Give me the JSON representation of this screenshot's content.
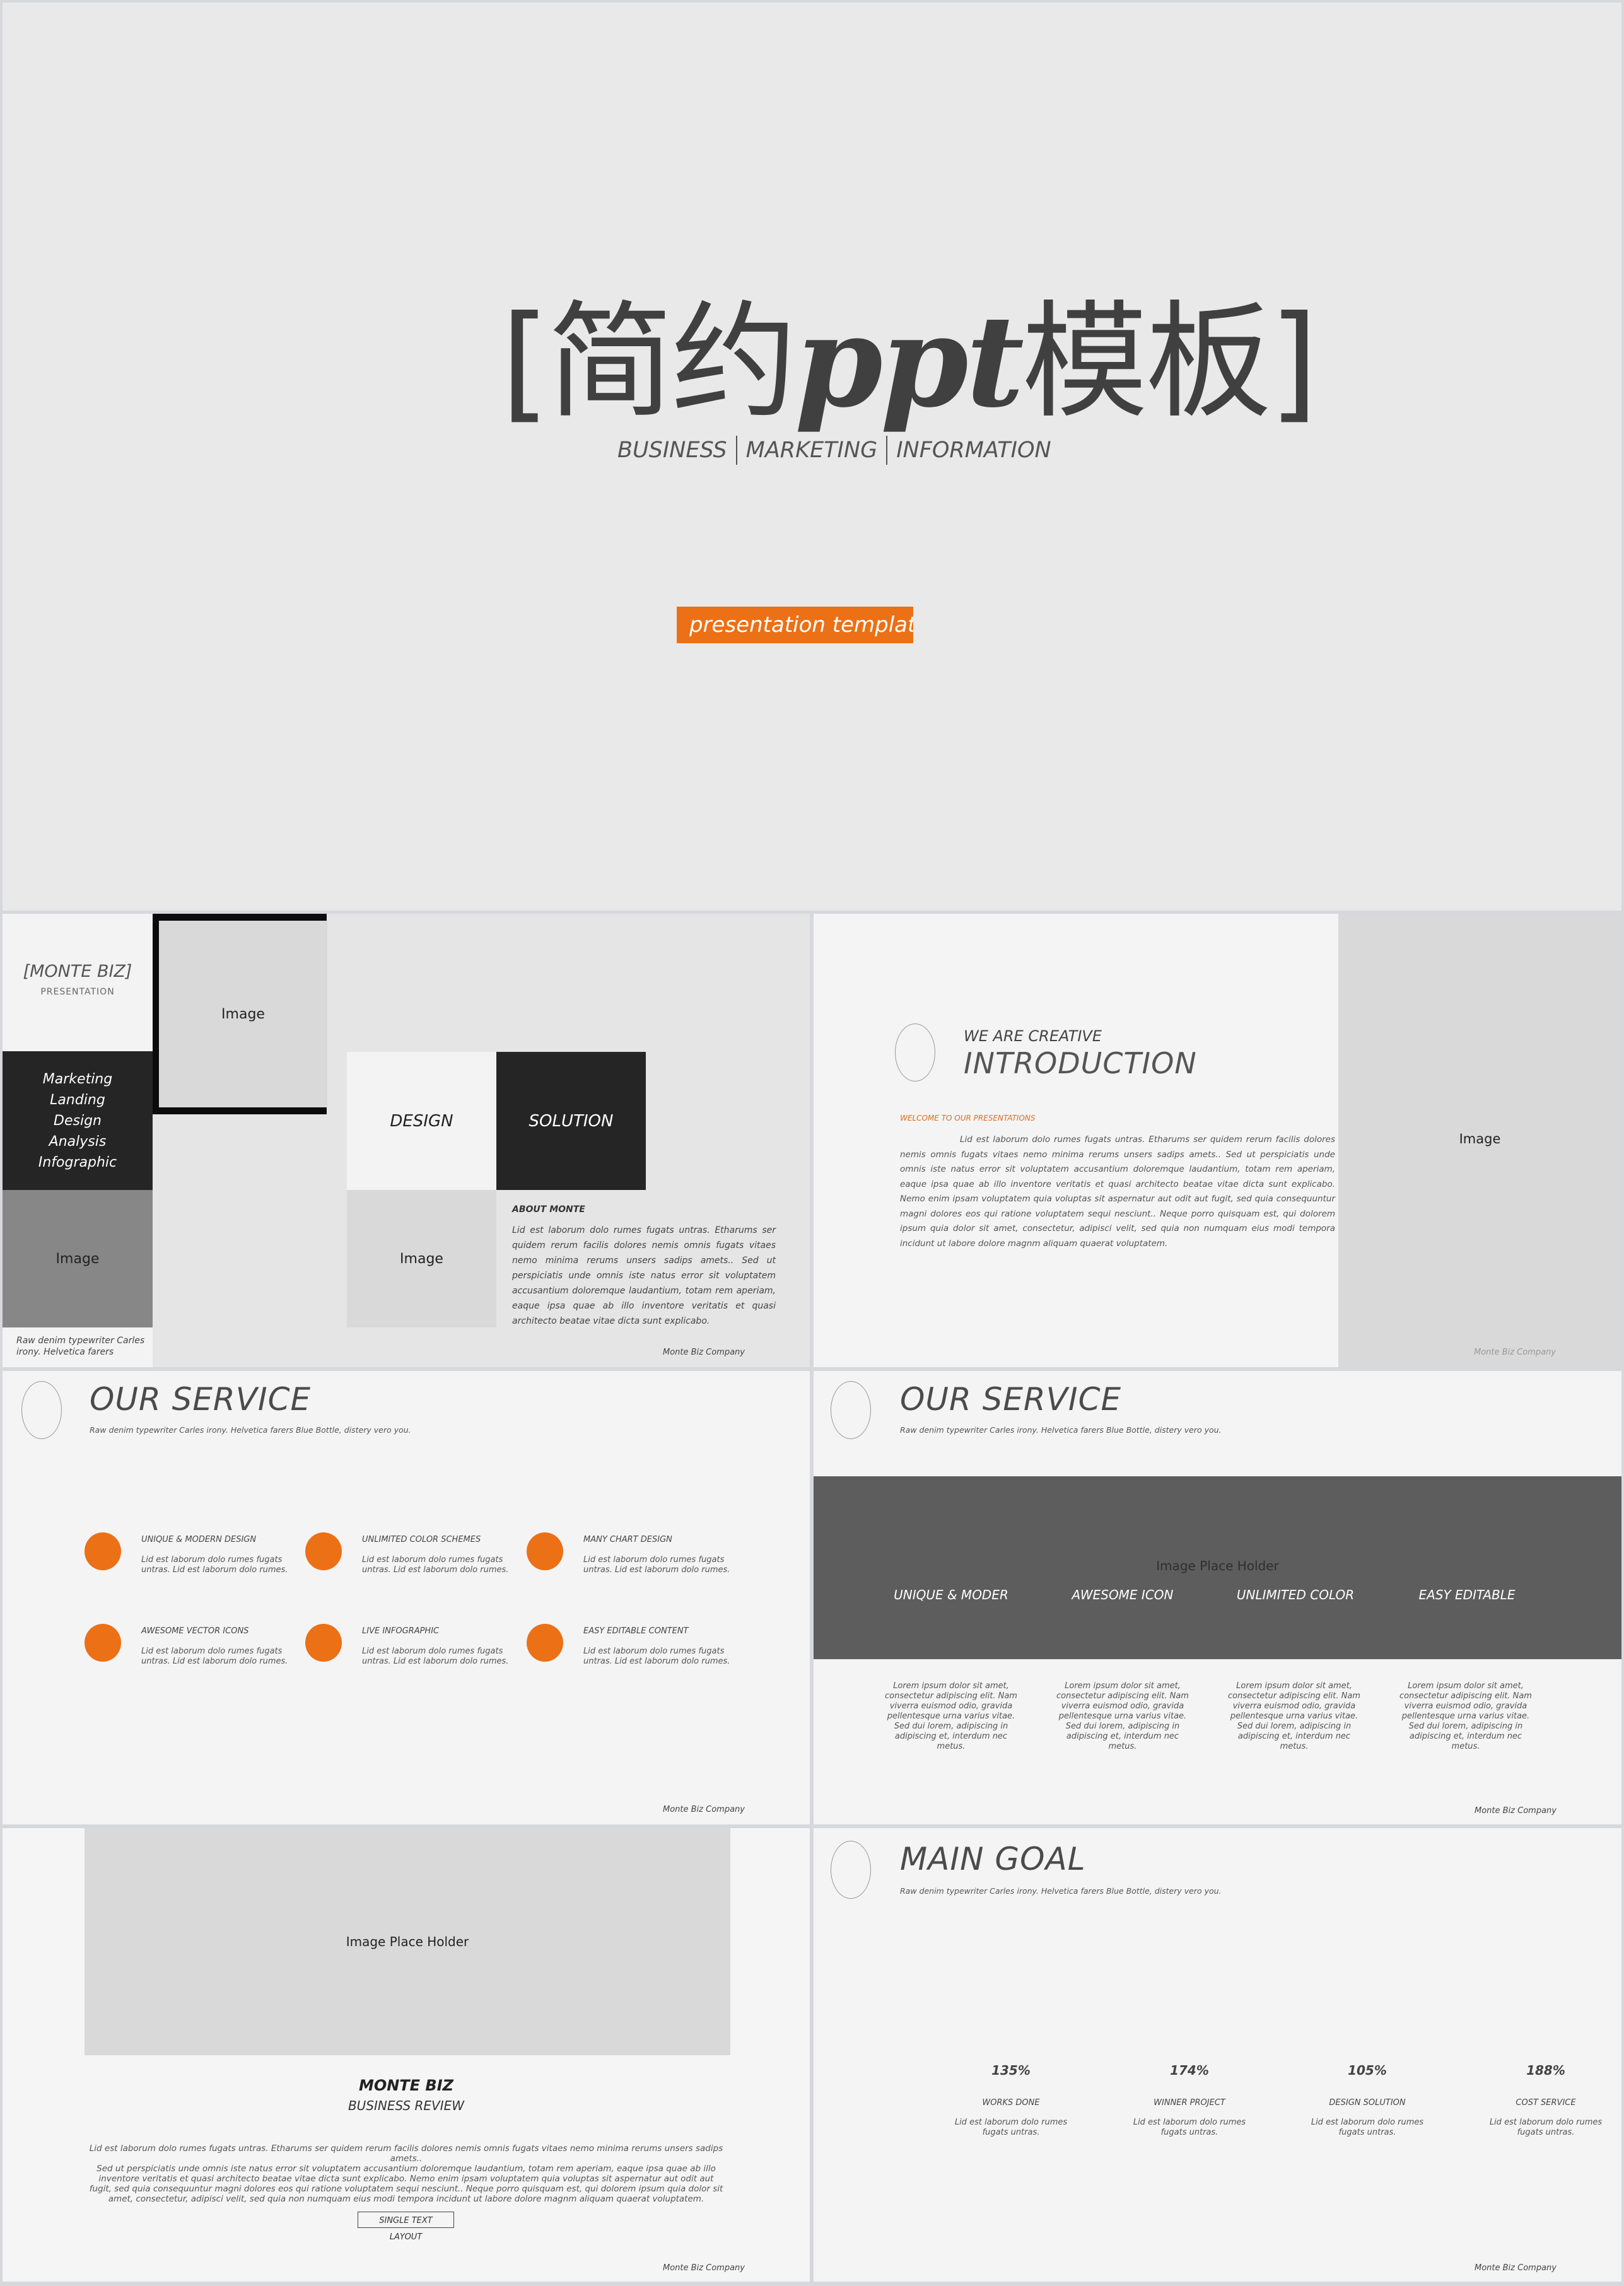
{
  "accent_color": "#ec7016",
  "slides": {
    "cover": {
      "title_open": "[",
      "title_cn1": "简约",
      "title_latin": "ppt",
      "title_cn2": "模板",
      "title_close": "]",
      "subtitle_items": [
        "BUSINESS",
        "MARKETING",
        "INFORMATION"
      ],
      "tag": "presentation template"
    },
    "monte": {
      "brand": "[MONTE BIZ]",
      "brand_sub": "PRESENTATION",
      "list": [
        "Marketing",
        "Landing",
        "Design",
        "Analysis",
        "Infographic"
      ],
      "image_label": "Image",
      "caption": "Raw denim typewriter Carles irony. Helvetica farers",
      "design": "DESIGN",
      "solution": "SOLUTION",
      "about_heading": "ABOUT MONTE",
      "about_body": "Lid est laborum dolo rumes fugats untras. Etharums ser quidem rerum facilis dolores nemis omnis fugats vitaes nemo minima rerums unsers sadips amets.. Sed ut perspiciatis unde omnis iste natus error sit voluptatem accusantium doloremque laudantium, totam rem aperiam, eaque ipsa quae ab illo inventore veritatis et quasi architecto beatae vitae dicta sunt explicabo.",
      "footer": "Monte Biz Company"
    },
    "intro": {
      "kicker": "WE ARE CREATIVE",
      "title": "INTRODUCTION",
      "welcome": "WELCOME TO OUR PRESENTATIONS",
      "body": "Lid est laborum dolo rumes fugats untras. Etharums ser quidem rerum facilis dolores nemis omnis fugats vitaes nemo minima rerums unsers sadips amets.. Sed ut perspiciatis unde omnis iste natus error sit voluptatem accusantium doloremque laudantium, totam rem aperiam, eaque ipsa quae ab illo inventore veritatis et quasi architecto beatae vitae dicta sunt explicabo. Nemo enim ipsam voluptatem quia voluptas sit aspernatur aut odit aut fugit, sed quia consequuntur magni dolores eos qui ratione voluptatem sequi nesciunt.. Neque porro quisquam est, qui dolorem ipsum quia dolor sit amet, consectetur, adipisci velit, sed quia non numquam eius modi tempora incidunt ut labore dolore magnm aliquam quaerat voluptatem.",
      "image_label": "Image",
      "footer": "Monte Biz Company"
    },
    "service1": {
      "title": "OUR SERVICE",
      "subtitle": "Raw denim typewriter Carles irony. Helvetica farers Blue Bottle, distery vero you.",
      "features": [
        {
          "heading": "UNIQUE & MODERN DESIGN",
          "body": "Lid est laborum dolo rumes fugats untras. Lid est laborum dolo rumes."
        },
        {
          "heading": "UNLIMITED COLOR SCHEMES",
          "body": "Lid est laborum dolo rumes fugats untras. Lid est laborum dolo rumes."
        },
        {
          "heading": "MANY CHART DESIGN",
          "body": "Lid est laborum dolo rumes fugats untras. Lid est laborum dolo rumes."
        },
        {
          "heading": "AWESOME VECTOR ICONS",
          "body": "Lid est laborum dolo rumes fugats untras. Lid est laborum dolo rumes."
        },
        {
          "heading": "LIVE INFOGRAPHIC",
          "body": "Lid est laborum dolo rumes fugats untras. Lid est laborum dolo rumes."
        },
        {
          "heading": "EASY EDITABLE CONTENT",
          "body": "Lid est laborum dolo rumes fugats untras. Lid est laborum dolo rumes."
        }
      ],
      "footer": "Monte Biz Company"
    },
    "service2": {
      "title": "OUR SERVICE",
      "subtitle": "Raw denim typewriter Carles irony. Helvetica farers Blue Bottle, distery vero you.",
      "placeholder": "Image Place Holder",
      "columns": [
        "UNIQUE & MODER",
        "AWESOME ICON",
        "UNLIMITED COLOR",
        "EASY EDITABLE"
      ],
      "column_body": "Lorem ipsum dolor sit amet, consectetur adipiscing elit. Nam viverra euismod odio, gravida pellentesque urna varius vitae. Sed dui lorem, adipiscing in adipiscing et, interdum nec metus.",
      "footer": "Monte Biz Company"
    },
    "review": {
      "placeholder": "Image Place Holder",
      "title": "MONTE BIZ",
      "subtitle": "BUSINESS REVIEW",
      "body_line1": "Lid est laborum dolo rumes fugats untras. Etharums ser quidem rerum facilis dolores nemis omnis fugats vitaes nemo minima rerums unsers sadips amets..",
      "body_line2": "Sed ut perspiciatis unde omnis iste natus error sit voluptatem accusantium doloremque laudantium, totam rem aperiam, eaque ipsa quae ab illo inventore veritatis et quasi architecto beatae vitae dicta sunt explicabo. Nemo enim ipsam voluptatem quia voluptas sit aspernatur aut odit aut fugit, sed quia consequuntur magni dolores eos qui ratione voluptatem sequi nesciunt.. Neque porro quisquam est, qui dolorem ipsum quia dolor sit amet, consectetur, adipisci velit, sed quia non numquam eius modi tempora incidunt ut labore dolore magnm aliquam quaerat voluptatem.",
      "button": "SINGLE TEXT LAYOUT",
      "footer": "Monte Biz Company"
    },
    "goal": {
      "title": "MAIN GOAL",
      "subtitle": "Raw denim typewriter Carles irony. Helvetica farers Blue Bottle, distery vero you.",
      "stats": [
        {
          "value": "135%",
          "label": "WORKS DONE",
          "body": "Lid est laborum dolo rumes fugats untras."
        },
        {
          "value": "174%",
          "label": "WINNER PROJECT",
          "body": "Lid est laborum dolo rumes fugats untras."
        },
        {
          "value": "105%",
          "label": "DESIGN SOLUTION",
          "body": "Lid est laborum dolo rumes fugats untras."
        },
        {
          "value": "188%",
          "label": "COST SERVICE",
          "body": "Lid est laborum dolo rumes fugats untras."
        }
      ],
      "footer": "Monte Biz Company"
    }
  }
}
